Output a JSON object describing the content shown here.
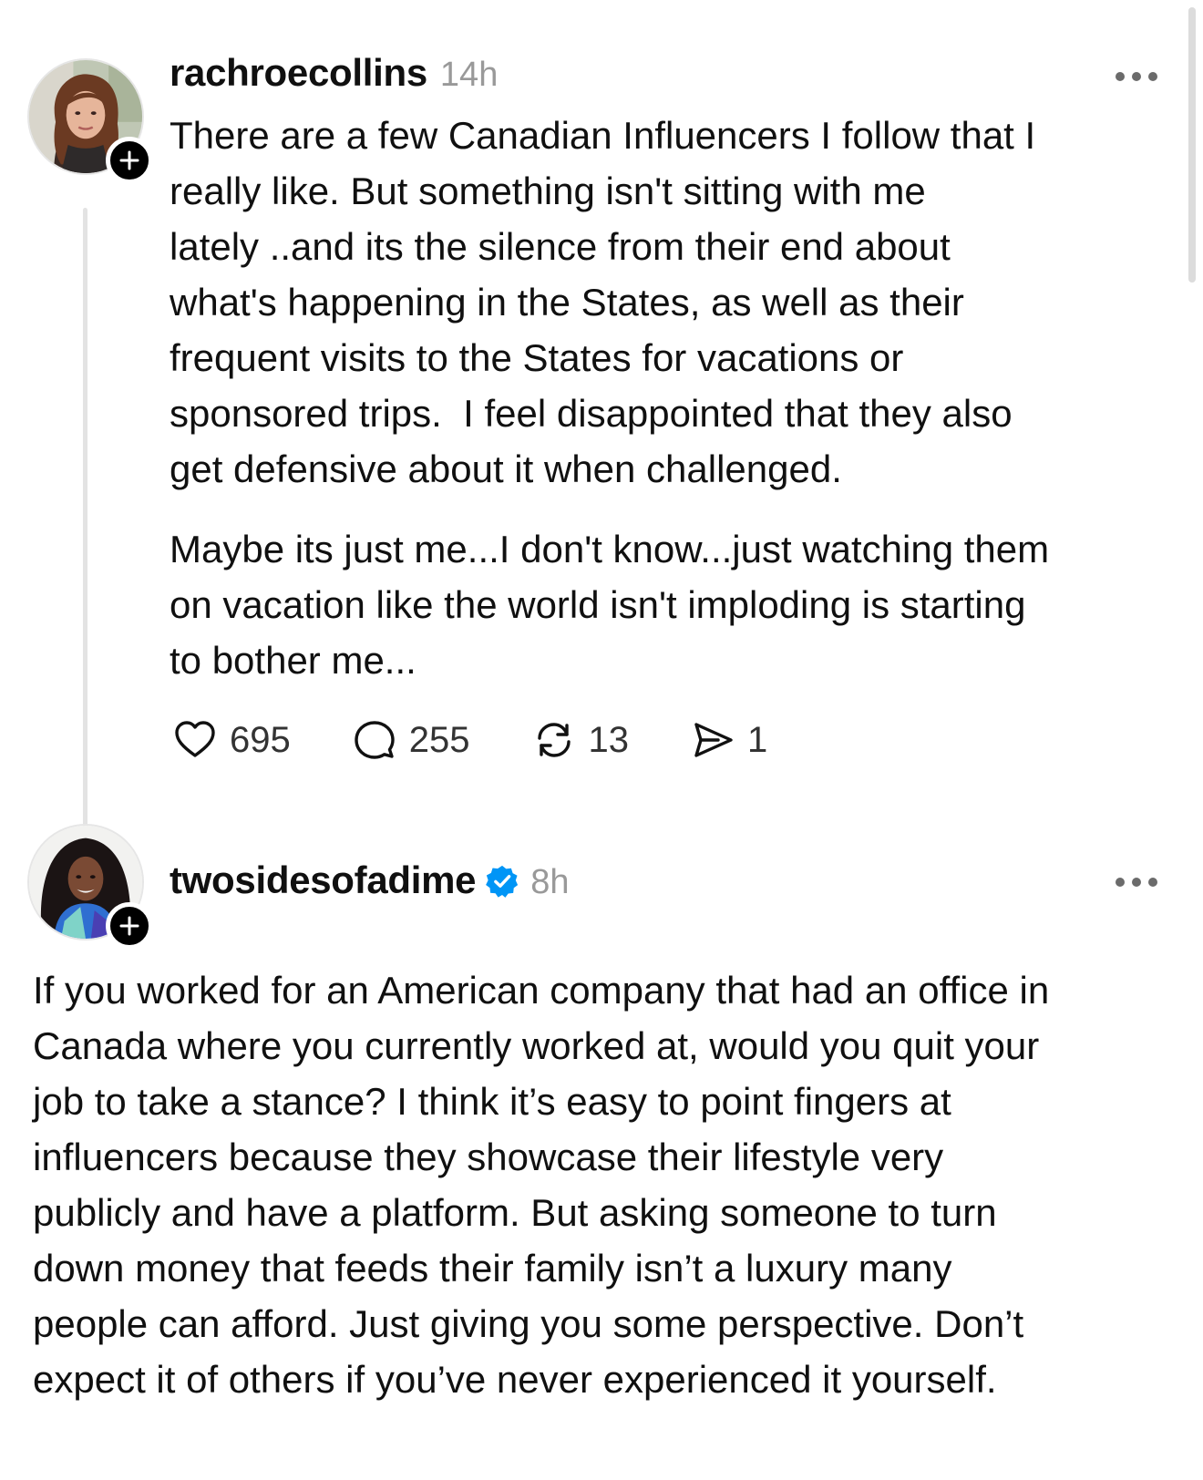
{
  "posts": [
    {
      "username": "rachroecollins",
      "time": "14h",
      "avatar_icon": "profile-photo-woman-curly-hair",
      "verified": false,
      "paragraphs": [
        "There are a few Canadian Influencers I follow that I\nreally like. But something isn't sitting with me\nlately ..and its the silence from their end about\nwhat's happening in the States, as well as their\nfrequent visits to the States for vacations or\nsponsored trips.  I feel disappointed that they also\nget defensive about it when challenged.",
        "Maybe its just me...I don't know...just watching them\non vacation like the world isn't imploding is starting\nto bother me..."
      ],
      "actions": {
        "likes": "695",
        "replies": "255",
        "reposts": "13",
        "shares": "1"
      }
    },
    {
      "username": "twosidesofadime",
      "time": "8h",
      "avatar_icon": "profile-photo-woman-long-dark-hair",
      "verified": true,
      "paragraphs": [
        "If you worked for an American company that had an office in\nCanada where you currently worked at, would you quit your\njob to take a stance? I think it’s easy to point fingers at\ninfluencers because they showcase their lifestyle very\npublicly and have a platform. But asking someone to turn\ndown money that feeds their family isn’t a luxury many\npeople can afford. Just giving you some perspective. Don’t\nexpect it of others if you’ve never experienced it yourself."
      ]
    }
  ],
  "colors": {
    "verified_badge": "#0095f6",
    "timestamp": "#999999",
    "text": "#101010",
    "thread_line": "#e3e3e3"
  }
}
